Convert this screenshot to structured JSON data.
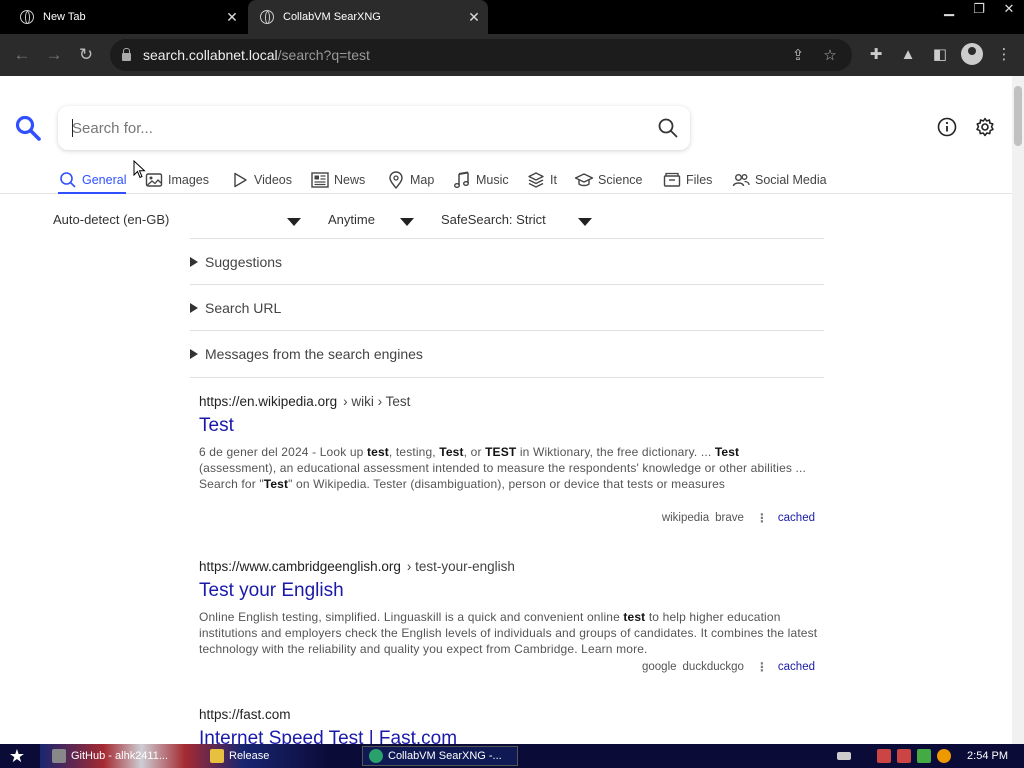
{
  "browser": {
    "tabs": [
      {
        "label": "New Tab"
      },
      {
        "label": "CollabVM SearXNG"
      }
    ],
    "url_host": "search.collabnet.local",
    "url_path": "/search?q=test"
  },
  "search": {
    "placeholder": "Search for...",
    "value": ""
  },
  "categories": [
    {
      "label": "General",
      "icon": "magnifier-icon",
      "active": true
    },
    {
      "label": "Images",
      "icon": "image-icon"
    },
    {
      "label": "Videos",
      "icon": "play-icon"
    },
    {
      "label": "News",
      "icon": "newspaper-icon"
    },
    {
      "label": "Map",
      "icon": "map-pin-icon"
    },
    {
      "label": "Music",
      "icon": "music-note-icon"
    },
    {
      "label": "It",
      "icon": "layers-icon"
    },
    {
      "label": "Science",
      "icon": "graduation-cap-icon"
    },
    {
      "label": "Files",
      "icon": "file-drawer-icon"
    },
    {
      "label": "Social Media",
      "icon": "people-icon"
    }
  ],
  "filters": {
    "language": "Auto-detect (en-GB)",
    "time": "Anytime",
    "safesearch": "SafeSearch: Strict"
  },
  "sections": [
    {
      "label": "Suggestions"
    },
    {
      "label": "Search URL"
    },
    {
      "label": "Messages from the search engines"
    }
  ],
  "results": [
    {
      "url": "https://en.wikipedia.org",
      "crumb": "› wiki › Test",
      "title": "Test",
      "snippet_html": "6 de gener del 2024 - Look up <b>test</b>, testing, <b>Test</b>, or <b>TEST</b> in Wiktionary, the free dictionary. ... <b>Test</b> (assessment), an educational assessment intended to measure the respondents' knowledge or other abilities ... Search for \"<b>Test</b>\" on Wikipedia. Tester (disambiguation), person or device that tests or measures",
      "engines": [
        "wikipedia",
        "brave"
      ],
      "cached": "cached"
    },
    {
      "url": "https://www.cambridgeenglish.org",
      "crumb": "› test-your-english",
      "title": "Test your English",
      "snippet_html": "Online English testing, simplified. Linguaskill is a quick and convenient online <b>test</b> to help higher education institutions and employers check the English levels of individuals and groups of candidates. It combines the latest technology with the reliability and quality you expect from Cambridge. Learn more.",
      "engines": [
        "google",
        "duckduckgo"
      ],
      "cached": "cached"
    },
    {
      "url": "https://fast.com",
      "crumb": "",
      "title": "Internet Speed Test | Fast.com"
    }
  ],
  "taskbar": {
    "items": [
      {
        "label": "GitHub - alhk2411..."
      },
      {
        "label": "Release"
      },
      {
        "label": "CollabVM SearXNG -..."
      }
    ],
    "clock": "2:54 PM"
  },
  "colors": {
    "accent": "#3050ff",
    "link": "#1a1aaa"
  }
}
